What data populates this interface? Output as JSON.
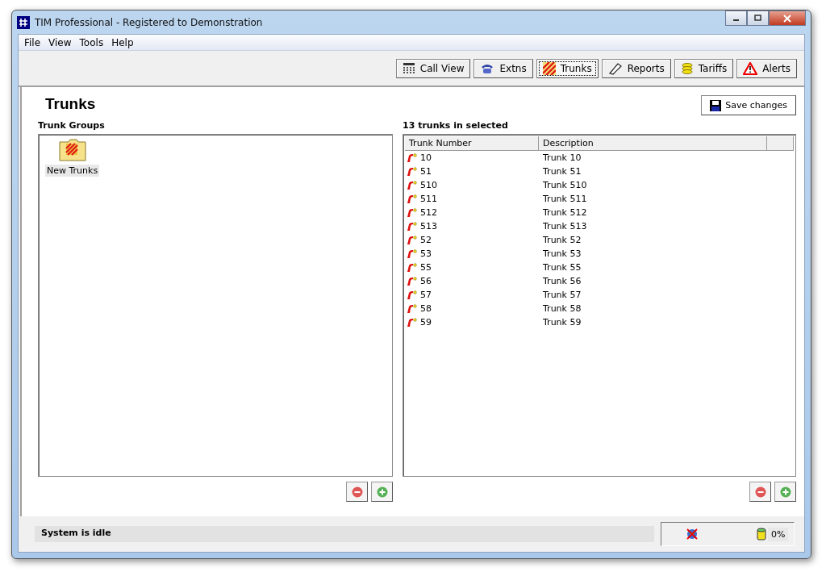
{
  "window": {
    "title": "TIM Professional - Registered to Demonstration"
  },
  "menu": [
    "File",
    "View",
    "Tools",
    "Help"
  ],
  "toolbar": [
    {
      "label": "Call View",
      "kind": "grid",
      "selected": false
    },
    {
      "label": "Extns",
      "kind": "phone",
      "selected": false
    },
    {
      "label": "Trunks",
      "kind": "trunks",
      "selected": true
    },
    {
      "label": "Reports",
      "kind": "pen",
      "selected": false
    },
    {
      "label": "Tariffs",
      "kind": "coins",
      "selected": false
    },
    {
      "label": "Alerts",
      "kind": "alert",
      "selected": false
    }
  ],
  "page": {
    "title": "Trunks",
    "save_button": "Save changes"
  },
  "groups": {
    "heading": "Trunk Groups",
    "items": [
      {
        "label": "New Trunks",
        "selected": true
      }
    ]
  },
  "trunks": {
    "heading": "13 trunks in selected",
    "columns": [
      "Trunk Number",
      "Description"
    ],
    "rows": [
      {
        "number": "10",
        "description": "Trunk 10"
      },
      {
        "number": "51",
        "description": "Trunk 51"
      },
      {
        "number": "510",
        "description": "Trunk 510"
      },
      {
        "number": "511",
        "description": "Trunk 511"
      },
      {
        "number": "512",
        "description": "Trunk 512"
      },
      {
        "number": "513",
        "description": "Trunk 513"
      },
      {
        "number": "52",
        "description": "Trunk 52"
      },
      {
        "number": "53",
        "description": "Trunk 53"
      },
      {
        "number": "55",
        "description": "Trunk 55"
      },
      {
        "number": "56",
        "description": "Trunk 56"
      },
      {
        "number": "57",
        "description": "Trunk 57"
      },
      {
        "number": "58",
        "description": "Trunk 58"
      },
      {
        "number": "59",
        "description": "Trunk 59"
      }
    ]
  },
  "status_bar": {
    "message": "System is idle",
    "usage": "0%"
  }
}
